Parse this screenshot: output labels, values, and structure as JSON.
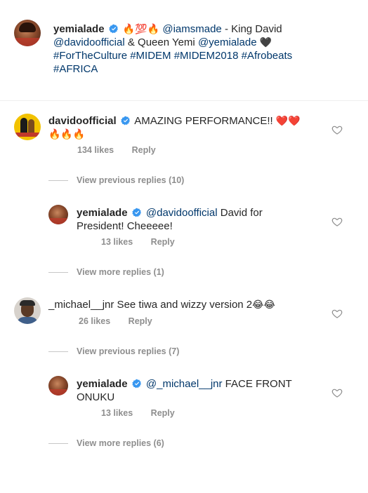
{
  "post": {
    "username": "yemialade",
    "emojis_1": "🔥💯🔥",
    "mention_1": "@iamsmade",
    "text_1": " -  King David",
    "mention_2": "@davidoofficial",
    "text_2": " & Queen Yemi ",
    "mention_3": "@yemialade",
    "emoji_heart": "🖤",
    "hashtags": "#ForTheCulture #MIDEM #MIDEM2018 #Afrobeats",
    "hashtag_last": "#AFRICA"
  },
  "comments": [
    {
      "username": "davidoofficial",
      "text": "AMAZING PERFORMANCE!! ",
      "emojis_inline": "❤️❤️",
      "emojis_line2": "🔥🔥🔥",
      "likes": "134 likes",
      "reply": "Reply",
      "view_replies": "View previous replies (10)"
    },
    {
      "username": "yemialade",
      "mention": "@davidoofficial",
      "text_1": " David for",
      "text_2": "President!  Cheeeee!",
      "likes": "13 likes",
      "reply": "Reply",
      "view_replies": "View more replies (1)"
    },
    {
      "username": "_michael__jnr",
      "text": " See tiwa and wizzy version 2",
      "emojis": "😂😂",
      "likes": "26 likes",
      "reply": "Reply",
      "view_replies": "View previous replies (7)"
    },
    {
      "username": "yemialade",
      "mention": "@_michael__jnr",
      "text_1": " FACE FRONT",
      "text_2": "ONUKU",
      "likes": "13 likes",
      "reply": "Reply",
      "view_replies": "View more replies (6)"
    }
  ],
  "icons": {
    "heart": "heart-outline-icon",
    "verified": "verified-badge-icon"
  },
  "colors": {
    "text": "#262626",
    "mention": "#00376b",
    "meta": "#8e8e8e",
    "verified": "#3897f0"
  }
}
